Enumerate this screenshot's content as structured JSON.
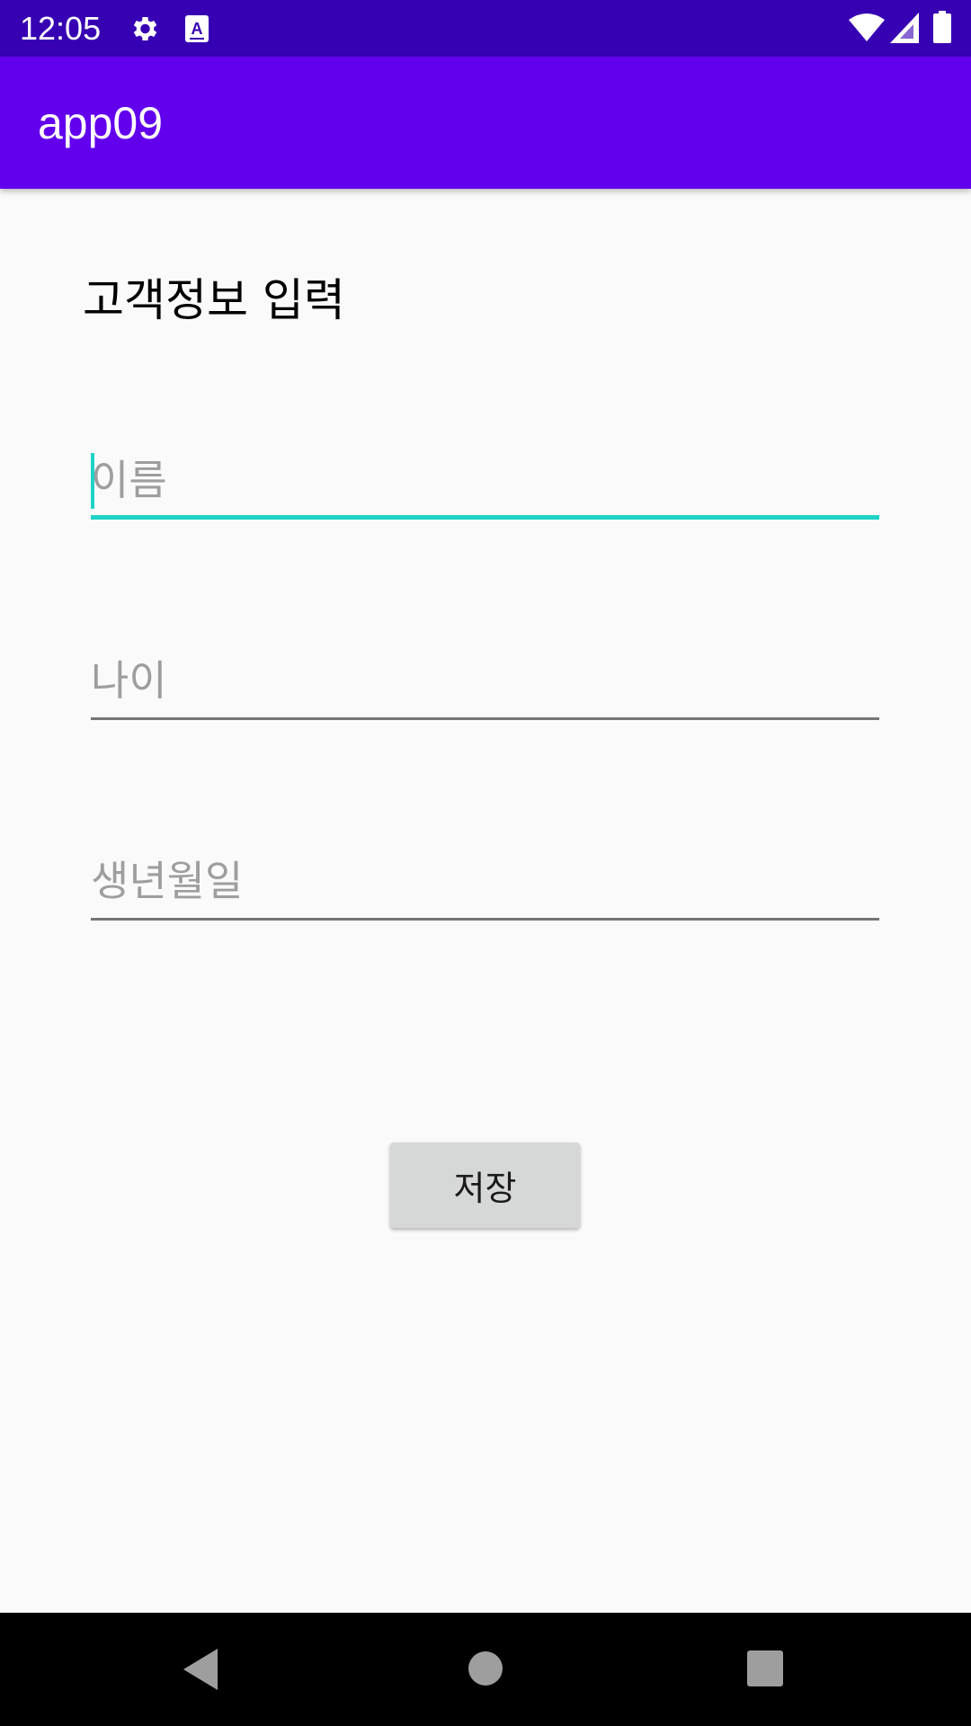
{
  "status_bar": {
    "time": "12:05",
    "icons": [
      "gear-icon",
      "keyboard-a-icon",
      "wifi-icon",
      "cellular-signal-icon",
      "battery-icon"
    ]
  },
  "app_bar": {
    "title": "app09",
    "color": "#6200ee"
  },
  "form": {
    "title": "고객정보 입력",
    "fields": [
      {
        "placeholder": "이름",
        "value": "",
        "focused": true
      },
      {
        "placeholder": "나이",
        "value": "",
        "focused": false
      },
      {
        "placeholder": "생년월일",
        "value": "",
        "focused": false
      }
    ],
    "accent_color": "#1ed3c6",
    "save_label": "저장"
  },
  "nav_bar": {
    "buttons": [
      "back-icon",
      "home-icon",
      "recents-icon"
    ]
  }
}
